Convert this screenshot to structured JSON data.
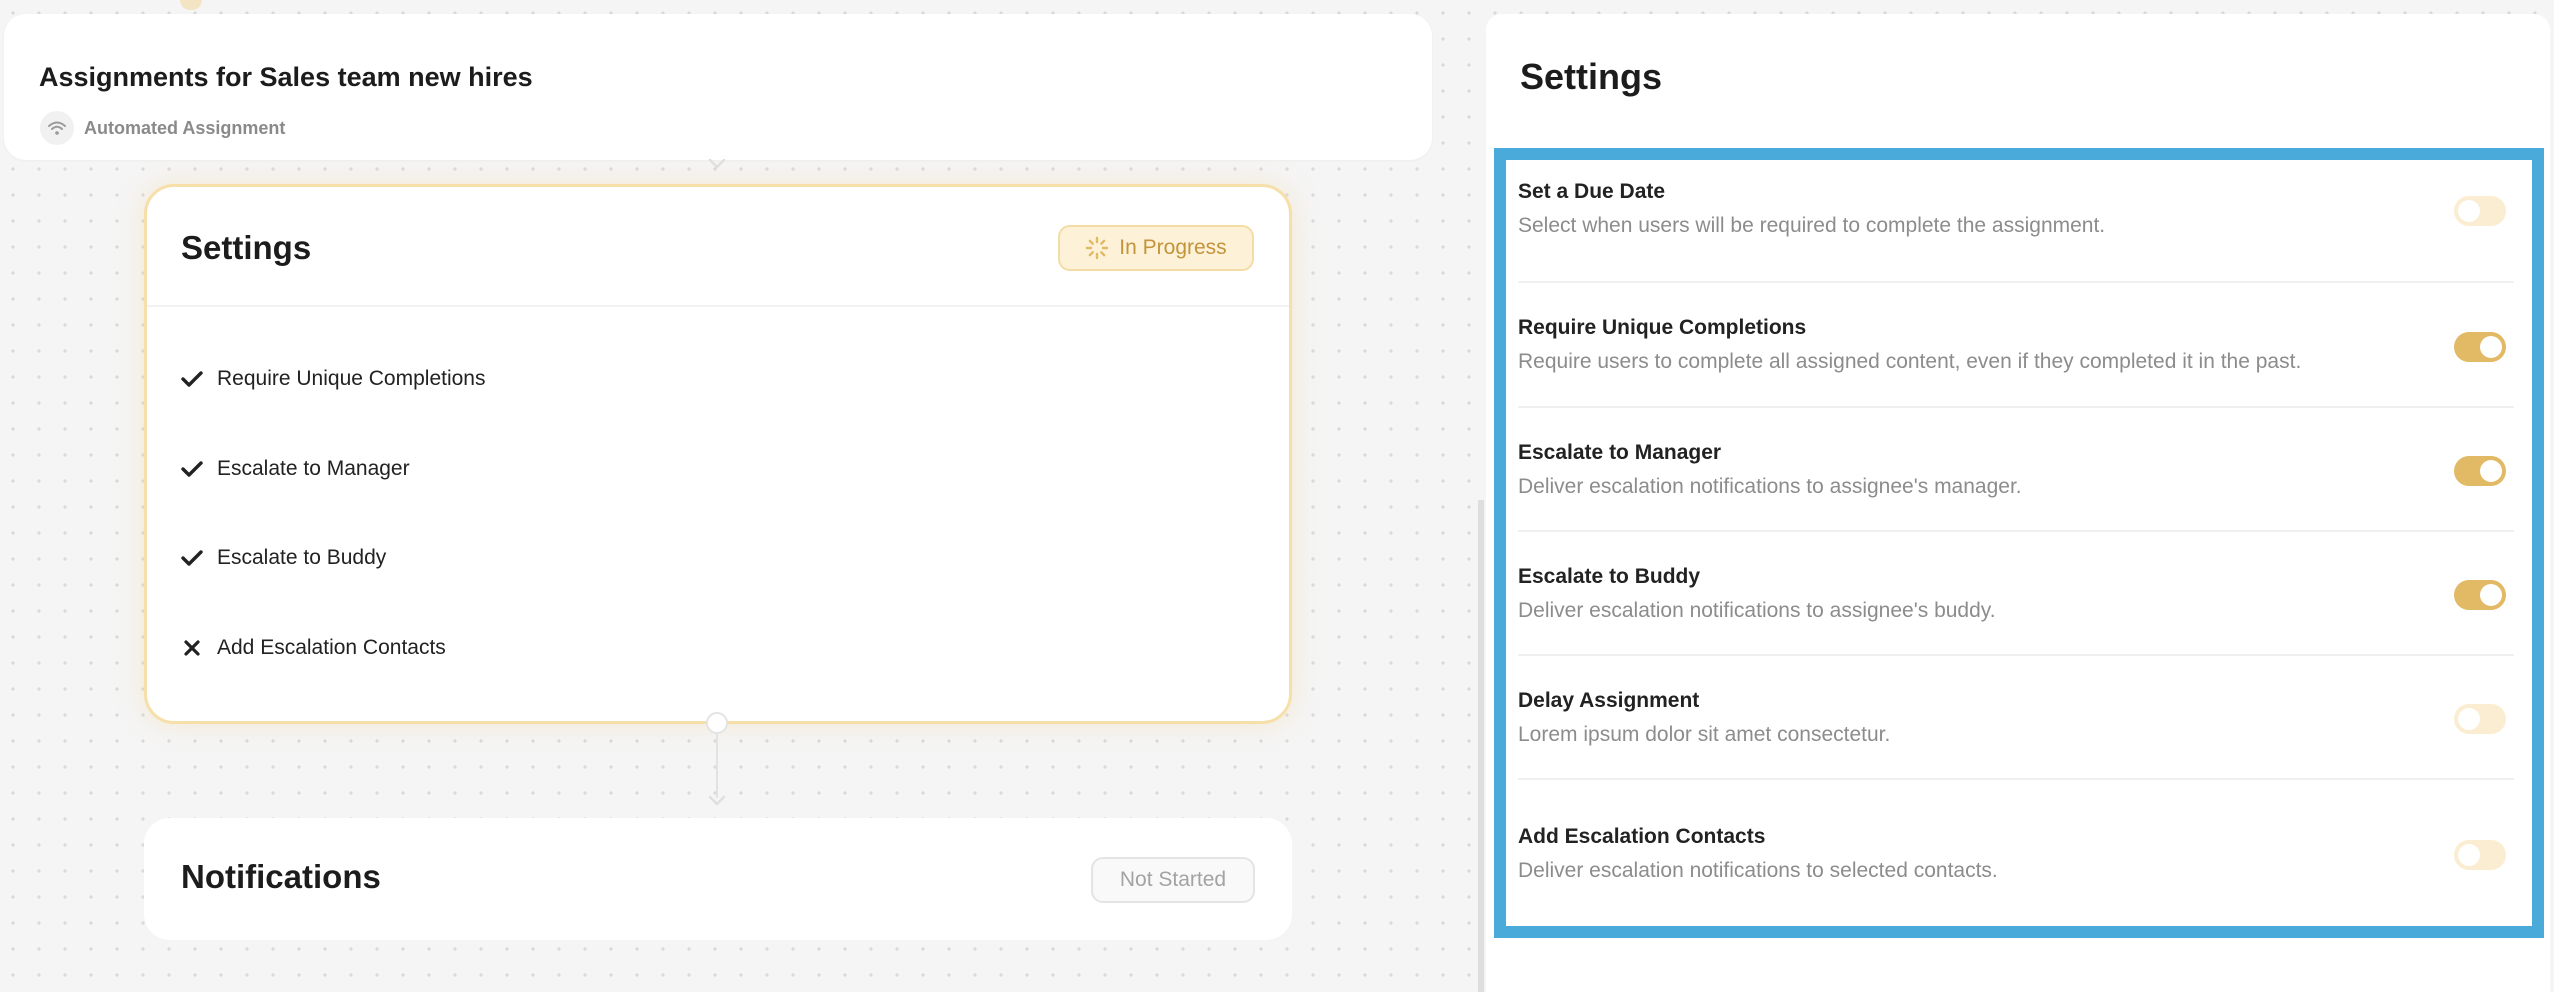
{
  "header": {
    "title": "Assignments for Sales team new hires",
    "subtitle": "Automated Assignment",
    "subtitle_icon": "wifi-icon"
  },
  "settings_node": {
    "title": "Settings",
    "status": "In Progress",
    "status_icon": "spinner-icon",
    "status_color": "#c4943a",
    "items": [
      {
        "label": "Require Unique Completions",
        "state": "check"
      },
      {
        "label": "Escalate to Manager",
        "state": "check"
      },
      {
        "label": "Escalate to Buddy",
        "state": "check"
      },
      {
        "label": "Add Escalation Contacts",
        "state": "cross"
      }
    ]
  },
  "notifications_node": {
    "title": "Notifications",
    "status": "Not Started"
  },
  "side_panel": {
    "title": "Settings",
    "accent_color": "#e2b964",
    "highlight_color": "#4aaad9",
    "settings": [
      {
        "name": "Set a Due Date",
        "description": "Select when users will be required to complete the assignment.",
        "enabled": false
      },
      {
        "name": "Require Unique Completions",
        "description": "Require users to complete all assigned content, even if they completed it in the past.",
        "enabled": true
      },
      {
        "name": "Escalate to Manager",
        "description": "Deliver escalation notifications to assignee's manager.",
        "enabled": true
      },
      {
        "name": "Escalate to Buddy",
        "description": "Deliver escalation notifications to assignee's buddy.",
        "enabled": true
      },
      {
        "name": "Delay Assignment",
        "description": "Lorem ipsum dolor sit amet consectetur.",
        "enabled": false
      },
      {
        "name": "Add Escalation Contacts",
        "description": "Deliver escalation notifications to selected contacts.",
        "enabled": false
      }
    ]
  }
}
